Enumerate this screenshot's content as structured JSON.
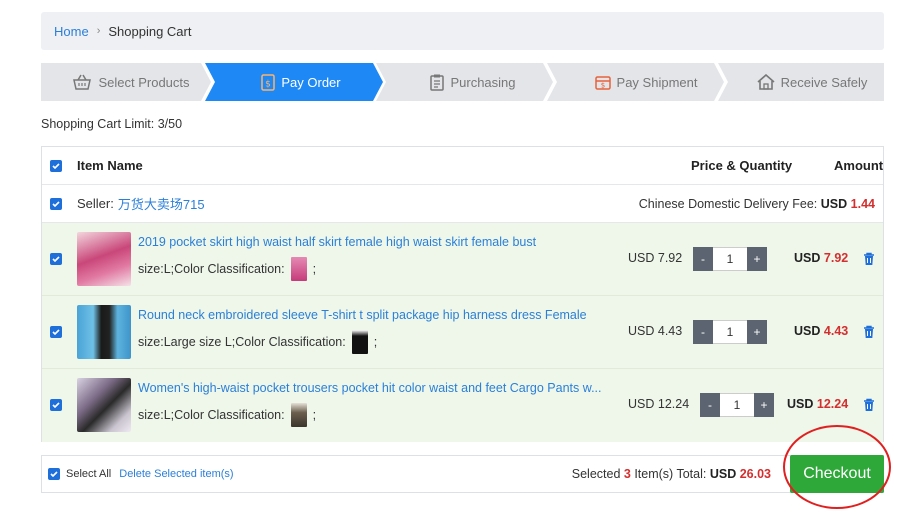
{
  "breadcrumb": {
    "home": "Home",
    "separator": "›",
    "current": "Shopping Cart"
  },
  "steps": [
    {
      "label": "Select Products",
      "icon": "basket-icon",
      "active": false
    },
    {
      "label": "Pay Order",
      "icon": "payment-icon",
      "active": true
    },
    {
      "label": "Purchasing",
      "icon": "clipboard-icon",
      "active": false
    },
    {
      "label": "Pay Shipment",
      "icon": "shipment-payment-icon",
      "active": false
    },
    {
      "label": "Receive Safely",
      "icon": "home-icon",
      "active": false
    }
  ],
  "cart_limit": "Shopping Cart Limit: 3/50",
  "table": {
    "col_item": "Item Name",
    "col_price": "Price & Quantity",
    "col_amount": "Amount"
  },
  "seller": {
    "label": "Seller:",
    "name": "万货大卖场715",
    "fee_label": "Chinese Domestic Delivery Fee:",
    "fee_currency": "USD",
    "fee_value": "1.44"
  },
  "items": [
    {
      "title": "2019 pocket skirt high waist half skirt female high waist skirt female bust",
      "props": "size:L;Color Classification:",
      "props_end": ";",
      "price": "USD 7.92",
      "qty": "1",
      "amount_currency": "USD",
      "amount_value": "7.92"
    },
    {
      "title": "Round neck embroidered sleeve T-shirt t split package hip harness dress Female",
      "props": "size:Large size L;Color Classification:",
      "props_end": ";",
      "price": "USD 4.43",
      "qty": "1",
      "amount_currency": "USD",
      "amount_value": "4.43"
    },
    {
      "title": "Women's high-waist pocket trousers pocket hit color waist and feet Cargo Pants w...",
      "props": "size:L;Color Classification:",
      "props_end": ";",
      "price": "USD 12.24",
      "qty": "1",
      "amount_currency": "USD",
      "amount_value": "12.24"
    }
  ],
  "qty_minus": "-",
  "qty_plus": "+",
  "footer": {
    "select_all": "Select All",
    "delete_selected": "Delete Selected item(s)",
    "selected_prefix": "Selected",
    "selected_count": "3",
    "selected_suffix": "Item(s)  Total:",
    "total_currency": "USD",
    "total_value": "26.03",
    "checkout": "Checkout"
  },
  "colors": {
    "active_step": "#1e88f5",
    "accent_blue": "#2b7fd9",
    "price_red": "#d32f2f",
    "checkout_green": "#2fa83a",
    "row_green": "#eef7ea"
  }
}
